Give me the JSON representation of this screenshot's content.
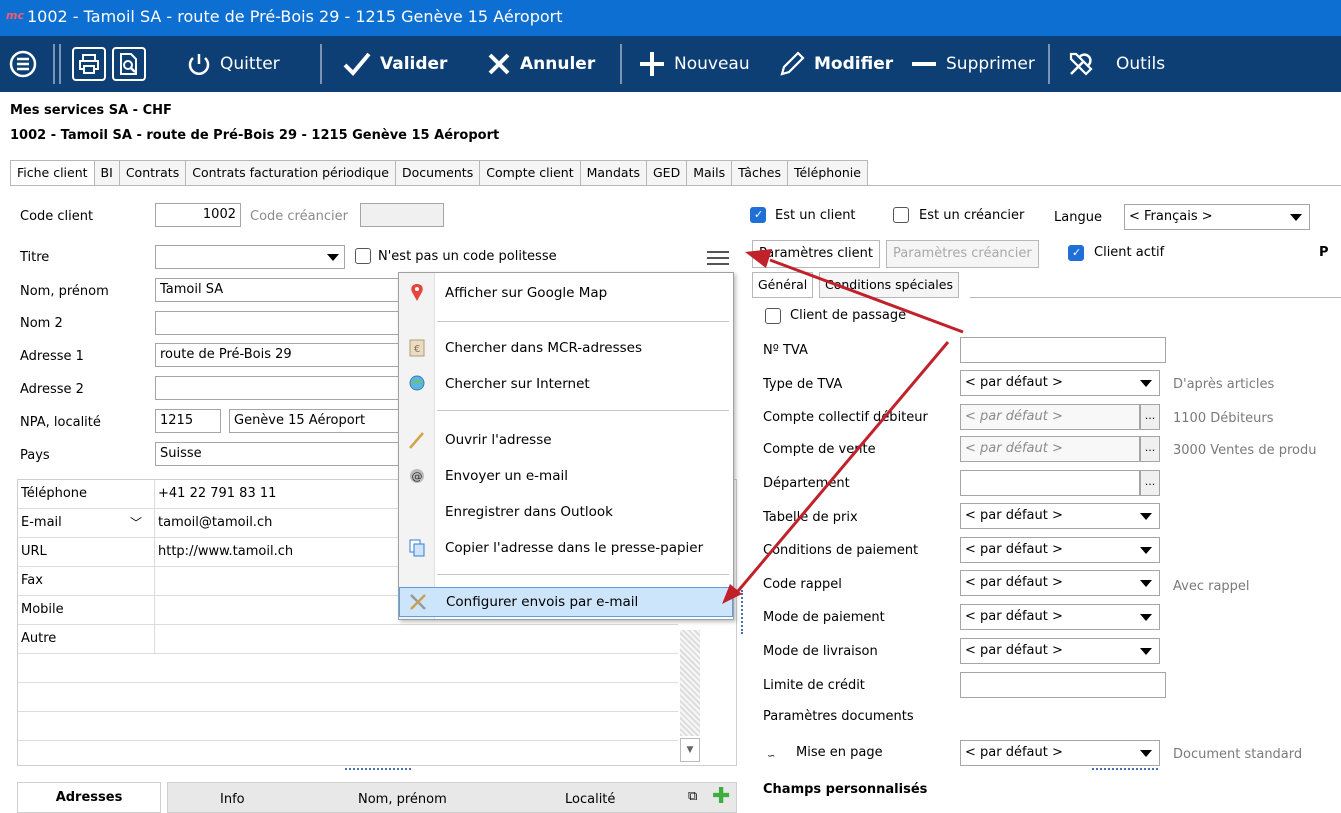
{
  "window": {
    "logo": "mc",
    "title": "1002 - Tamoil SA - route de Pré-Bois 29 - 1215 Genève 15 Aéroport"
  },
  "toolbar": {
    "quit": "Quitter",
    "validate": "Valider",
    "cancel": "Annuler",
    "new": "Nouveau",
    "edit": "Modifier",
    "delete": "Supprimer",
    "tools": "Outils"
  },
  "header": {
    "company": "Mes services SA  -  CHF",
    "record": "1002 - Tamoil SA - route de Pré-Bois 29 - 1215 Genève 15 Aéroport"
  },
  "tabs": [
    "Fiche client",
    "BI",
    "Contrats",
    "Contrats facturation périodique",
    "Documents",
    "Compte client",
    "Mandats",
    "GED",
    "Mails",
    "Tâches",
    "Téléphonie"
  ],
  "left": {
    "code_client_label": "Code client",
    "code_client_value": "1002",
    "code_creancier_label": "Code créancier",
    "titre_label": "Titre",
    "politesse_label": "N'est pas un code politesse",
    "nom_label": "Nom, prénom",
    "nom_value": "Tamoil SA",
    "nom2_label": "Nom 2",
    "adresse1_label": "Adresse 1",
    "adresse1_value": "route de Pré-Bois 29",
    "adresse2_label": "Adresse 2",
    "npa_label": "NPA, localité",
    "npa_value": "1215",
    "localite_value": "Genève 15 Aéroport",
    "pays_label": "Pays",
    "pays_value": "Suisse"
  },
  "contacts": [
    {
      "key": "Téléphone",
      "value": "+41 22 791 83 11"
    },
    {
      "key": "E-mail",
      "value": "tamoil@tamoil.ch"
    },
    {
      "key": "URL",
      "value": "http://www.tamoil.ch"
    },
    {
      "key": "Fax",
      "value": ""
    },
    {
      "key": "Mobile",
      "value": ""
    },
    {
      "key": "Autre",
      "value": ""
    }
  ],
  "context_menu": {
    "items": [
      "Afficher sur Google Map",
      "Chercher dans MCR-adresses",
      "Chercher sur Internet",
      "Ouvrir l'adresse",
      "Envoyer un e-mail",
      "Enregistrer dans Outlook",
      "Copier l'adresse dans le presse-papier",
      "Configurer envois par e-mail"
    ]
  },
  "bottom": {
    "adresses": "Adresses",
    "col_info": "Info",
    "col_nom": "Nom, prénom",
    "col_localite": "Localité"
  },
  "right": {
    "est_client": "Est un client",
    "est_creancier": "Est un créancier",
    "langue_label": "Langue",
    "langue_value": "< Français >",
    "tab_param_client": "Paramètres client",
    "tab_param_creancier": "Paramètres créancier",
    "client_actif": "Client actif",
    "edge_letter": "P",
    "subtab_general": "Général",
    "subtab_conditions": "Conditions spéciales",
    "client_passage": "Client de passage",
    "tva_label": "Nº TVA",
    "type_tva_label": "Type de TVA",
    "type_tva_value": "< par défaut >",
    "type_tva_side": "D'après articles",
    "compte_coll_label": "Compte collectif débiteur",
    "compte_coll_value": "< par défaut >",
    "compte_coll_side": "1100 Débiteurs",
    "compte_vente_label": "Compte  de vente",
    "compte_vente_value": "< par défaut >",
    "compte_vente_side": "3000 Ventes de produ",
    "departement_label": "Département",
    "tabelle_label": "Tabelle de prix",
    "tabelle_value": "< par défaut >",
    "conditions_label": "Conditions de paiement",
    "conditions_value": "< par défaut >",
    "rappel_label": "Code rappel",
    "rappel_value": "< par défaut >",
    "rappel_side": "Avec rappel",
    "mode_paiement_label": "Mode de paiement",
    "mode_paiement_value": "< par défaut >",
    "mode_livraison_label": "Mode de livraison",
    "mode_livraison_value": "< par défaut >",
    "limite_label": "Limite de crédit",
    "param_docs_label": "Paramètres documents",
    "mise_en_page_label": "Mise en page",
    "mise_en_page_value": "< par défaut >",
    "mise_en_page_side": "Document standard",
    "champs_label": "Champs personnalisés"
  },
  "colors": {
    "titlebar": "#0d6fd1",
    "toolbar": "#0d3f75",
    "arrow": "#c0212b"
  }
}
